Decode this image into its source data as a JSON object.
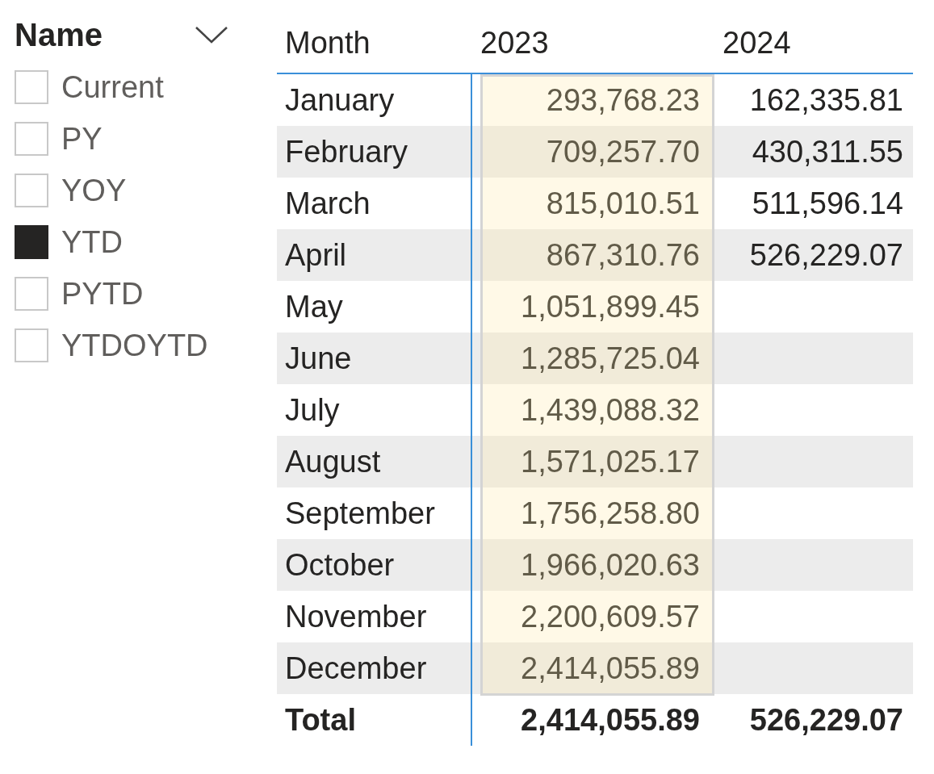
{
  "slicer": {
    "title": "Name",
    "items": [
      {
        "label": "Current",
        "checked": false
      },
      {
        "label": "PY",
        "checked": false
      },
      {
        "label": "YOY",
        "checked": false
      },
      {
        "label": "YTD",
        "checked": true
      },
      {
        "label": "PYTD",
        "checked": false
      },
      {
        "label": "YTDOYTD",
        "checked": false
      }
    ]
  },
  "matrix": {
    "columns": [
      {
        "label": "Month",
        "selected": false
      },
      {
        "label": "2023",
        "selected": true
      },
      {
        "label": "2024",
        "selected": false
      }
    ],
    "rows": [
      {
        "month": "January",
        "values": [
          "293,768.23",
          "162,335.81"
        ]
      },
      {
        "month": "February",
        "values": [
          "709,257.70",
          "430,311.55"
        ]
      },
      {
        "month": "March",
        "values": [
          "815,010.51",
          "511,596.14"
        ]
      },
      {
        "month": "April",
        "values": [
          "867,310.76",
          "526,229.07"
        ]
      },
      {
        "month": "May",
        "values": [
          "1,051,899.45"
        ]
      },
      {
        "month": "June",
        "values": [
          "1,285,725.04"
        ]
      },
      {
        "month": "July",
        "values": [
          "1,439,088.32"
        ]
      },
      {
        "month": "August",
        "values": [
          "1,571,025.17"
        ]
      },
      {
        "month": "September",
        "values": [
          "1,756,258.80"
        ]
      },
      {
        "month": "October",
        "values": [
          "1,966,020.63"
        ]
      },
      {
        "month": "November",
        "values": [
          "2,200,609.57"
        ]
      },
      {
        "month": "December",
        "values": [
          "2,414,055.89"
        ]
      }
    ],
    "total": {
      "label": "Total",
      "values": [
        "2,414,055.89",
        "526,229.07"
      ]
    }
  }
}
